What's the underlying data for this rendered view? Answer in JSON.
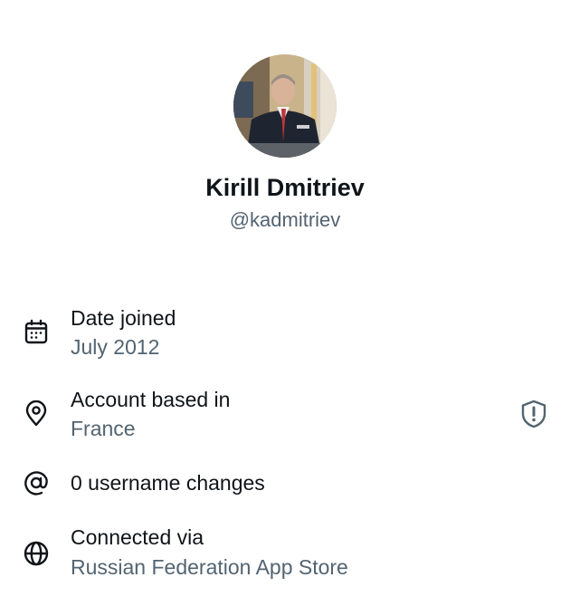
{
  "profile": {
    "display_name": "Kirill Dmitriev",
    "handle": "@kadmitriev"
  },
  "about": {
    "date_joined": {
      "label": "Date joined",
      "value": "July 2012",
      "icon": "calendar-icon"
    },
    "account_location": {
      "label": "Account based in",
      "value": "France",
      "icon": "location-pin-icon",
      "action_icon": "shield-alert-icon"
    },
    "username_changes": {
      "label": "0 username changes",
      "icon": "at-sign-icon"
    },
    "connected_via": {
      "label": "Connected via",
      "value": "Russian Federation App Store",
      "icon": "globe-icon"
    }
  },
  "colors": {
    "primary_text": "#0f1419",
    "secondary_text": "#536471"
  }
}
